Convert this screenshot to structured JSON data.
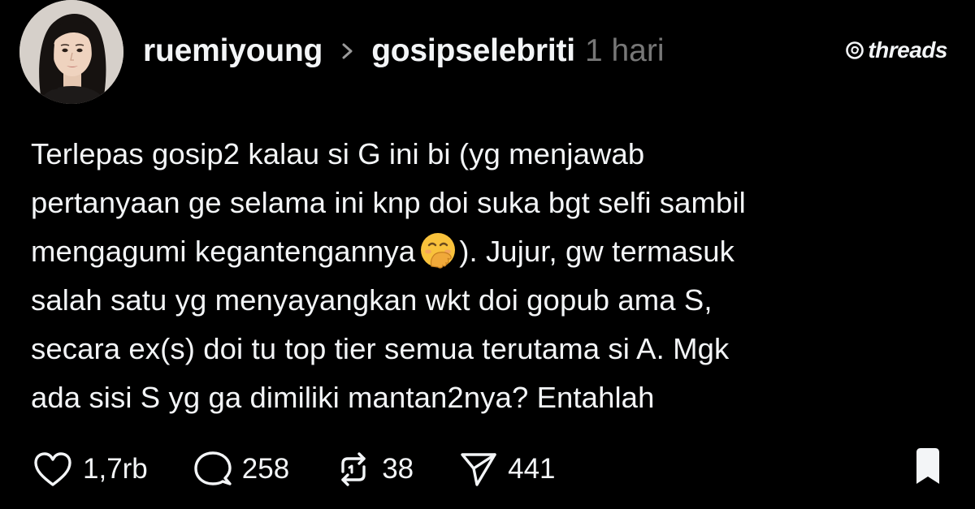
{
  "post": {
    "username": "ruemiyoung",
    "community": "gosipselebriti",
    "time": "1 hari",
    "brand": "threads",
    "text_lines": [
      "Terlepas gosip2 kalau si G ini bi (yg menjawab",
      "pertanyaan ge selama ini knp doi suka bgt selfi sambil",
      "mengagumi kegantengannya",
      "). Jujur, gw termasuk",
      "salah satu yg menyayangkan wkt doi gopub ama S,",
      "secara ex(s) doi tu top tier semua terutama si A. Mgk",
      "ada sisi S yg ga dimiliki mantan2nya? Entahlah"
    ],
    "emoji": "face-with-hand-over-mouth"
  },
  "actions": {
    "likes": "1,7rb",
    "replies": "258",
    "reposts": "38",
    "shares": "441"
  },
  "icons": {
    "like": "heart-icon",
    "reply": "speech-bubble-icon",
    "repost": "repost-icon",
    "share": "send-icon",
    "save": "bookmark-icon",
    "separator": "chevron-right-icon"
  },
  "colors": {
    "background": "#000000",
    "text": "#f3f5f7",
    "muted": "#777777"
  }
}
